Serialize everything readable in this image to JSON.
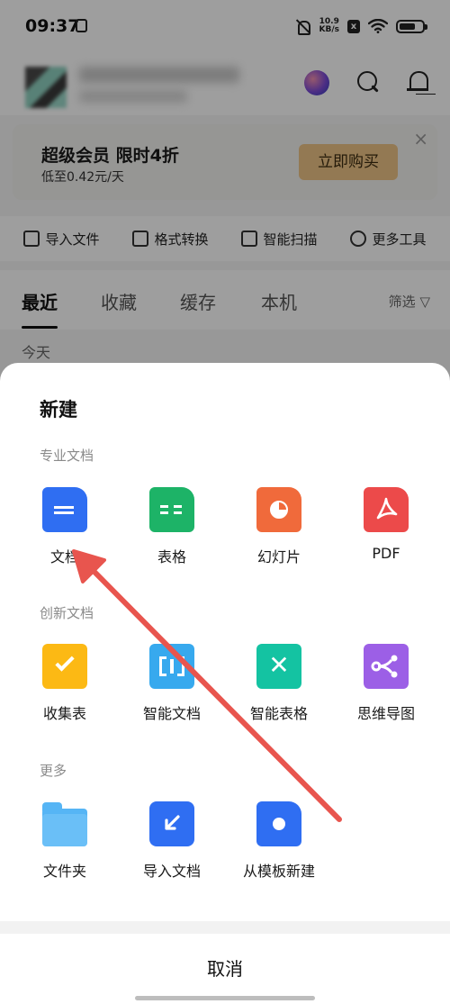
{
  "status_bar": {
    "time": "09:37",
    "net_speed_value": "10.9",
    "net_speed_unit": "KB/s",
    "sim_badge": "x",
    "battery_level": 0.72
  },
  "vip_banner": {
    "title": "超级会员 限时4折",
    "subtitle": "低至0.42元/天",
    "buy_label": "立即购买",
    "close": "×",
    "button_color": "#eec487"
  },
  "tools": [
    {
      "label": "导入文件",
      "icon": "import-file-icon"
    },
    {
      "label": "格式转换",
      "icon": "convert-format-icon"
    },
    {
      "label": "智能扫描",
      "icon": "scan-icon"
    },
    {
      "label": "更多工具",
      "icon": "more-tools-icon"
    }
  ],
  "file_tabs": {
    "items": [
      "最近",
      "收藏",
      "缓存",
      "本机"
    ],
    "active_index": 0,
    "filter_label": "筛选"
  },
  "section_today": "今天",
  "sheet": {
    "title": "新建",
    "sections": [
      {
        "label": "专业文档",
        "items": [
          {
            "label": "文档",
            "icon": "document-icon",
            "color": "#2f6ef2"
          },
          {
            "label": "表格",
            "icon": "spreadsheet-icon",
            "color": "#1db367"
          },
          {
            "label": "幻灯片",
            "icon": "presentation-icon",
            "color": "#f06a3b"
          },
          {
            "label": "PDF",
            "icon": "pdf-icon",
            "color": "#ec4a4a"
          }
        ]
      },
      {
        "label": "创新文档",
        "items": [
          {
            "label": "收集表",
            "icon": "form-icon",
            "color": "#fcb914"
          },
          {
            "label": "智能文档",
            "icon": "smart-document-icon",
            "color": "#37a9ee"
          },
          {
            "label": "智能表格",
            "icon": "smart-sheet-icon",
            "color": "#14c3a2"
          },
          {
            "label": "思维导图",
            "icon": "mind-map-icon",
            "color": "#9c5fe6"
          }
        ]
      },
      {
        "label": "更多",
        "items": [
          {
            "label": "文件夹",
            "icon": "folder-icon",
            "color": "#56b5f5"
          },
          {
            "label": "导入文档",
            "icon": "import-document-icon",
            "color": "#2f6ef2"
          },
          {
            "label": "从模板新建",
            "icon": "template-icon",
            "color": "#2f6ef2"
          }
        ]
      }
    ],
    "cancel_label": "取消"
  },
  "annotation": {
    "type": "red-arrow",
    "points_to": "文档",
    "color": "#e8554e"
  }
}
